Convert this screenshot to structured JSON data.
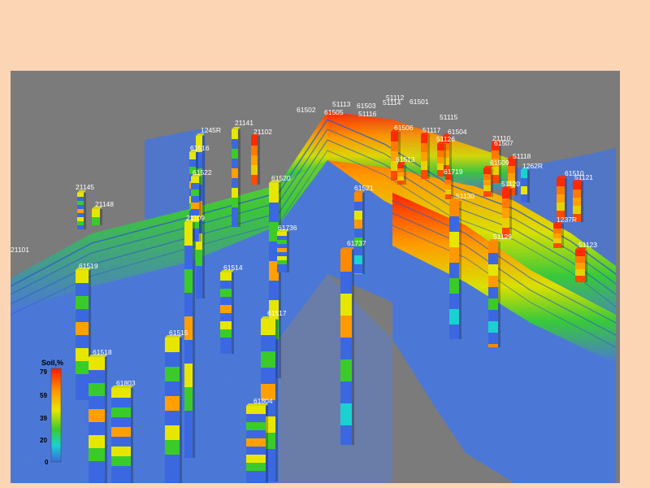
{
  "legend": {
    "title": "Soil,%",
    "ticks": [
      "79",
      "59",
      "39",
      "20",
      "0"
    ],
    "colors": [
      "#ff1a00",
      "#ff9a00",
      "#e6e600",
      "#3acb2a",
      "#19d2d0",
      "#3b68e0"
    ]
  },
  "colors": {
    "page_background": "#fcd5b5",
    "viewport_background": "#7b7b7b",
    "formation_blue": "#4b78d6"
  },
  "wells": [
    {
      "label": "61502"
    },
    {
      "label": "61505"
    },
    {
      "label": "51113"
    },
    {
      "label": "61503"
    },
    {
      "label": "51114"
    },
    {
      "label": "51112"
    },
    {
      "label": "61501"
    },
    {
      "label": "51116"
    },
    {
      "label": "51115"
    },
    {
      "label": "61506"
    },
    {
      "label": "51117"
    },
    {
      "label": "61504"
    },
    {
      "label": "51126"
    },
    {
      "label": "21110"
    },
    {
      "label": "61507"
    },
    {
      "label": "51118"
    },
    {
      "label": "61509"
    },
    {
      "label": "1262R"
    },
    {
      "label": "61513"
    },
    {
      "label": "61719"
    },
    {
      "label": "51120"
    },
    {
      "label": "61510"
    },
    {
      "label": "51121"
    },
    {
      "label": "51130"
    },
    {
      "label": "1237R"
    },
    {
      "label": "51129"
    },
    {
      "label": "51123"
    },
    {
      "label": "1245R"
    },
    {
      "label": "21141"
    },
    {
      "label": "21102"
    },
    {
      "label": "61516"
    },
    {
      "label": "61522"
    },
    {
      "label": "21145"
    },
    {
      "label": "21148"
    },
    {
      "label": "61520"
    },
    {
      "label": "61521"
    },
    {
      "label": "21109"
    },
    {
      "label": "61736"
    },
    {
      "label": "21101"
    },
    {
      "label": "61737"
    },
    {
      "label": "61519"
    },
    {
      "label": "61514"
    },
    {
      "label": "61517"
    },
    {
      "label": "61515"
    },
    {
      "label": "61518"
    },
    {
      "label": "61803"
    },
    {
      "label": "61804"
    }
  ]
}
